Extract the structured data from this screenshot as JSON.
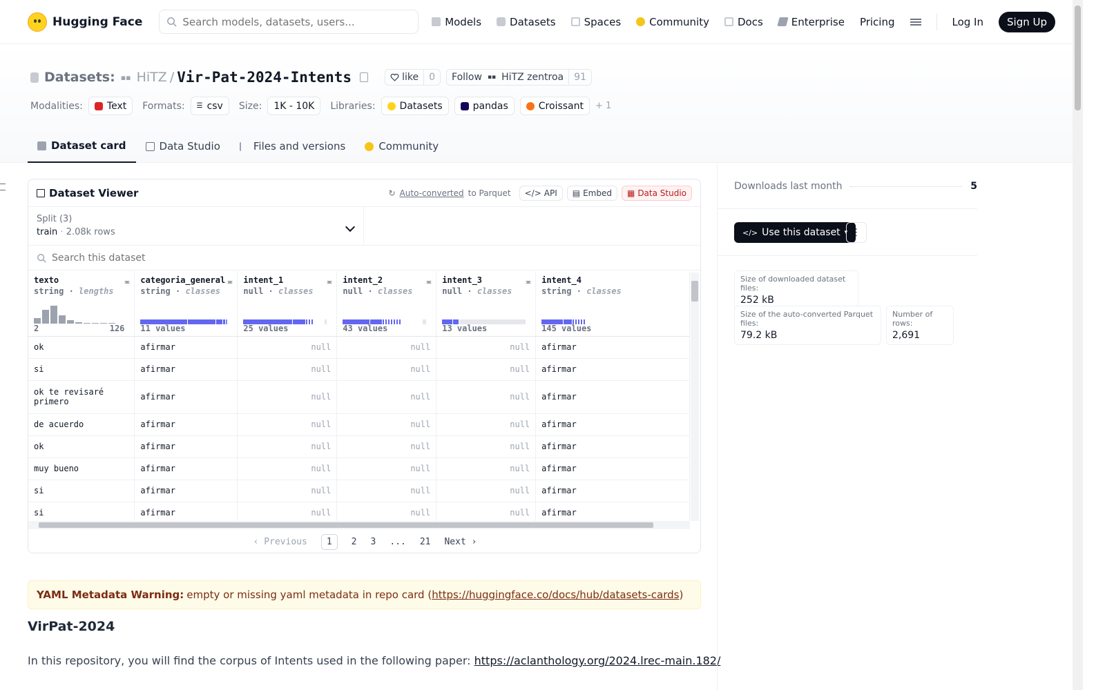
{
  "nav": {
    "brand": "Hugging Face",
    "search_placeholder": "Search models, datasets, users...",
    "links": [
      "Models",
      "Datasets",
      "Spaces",
      "Community",
      "Docs",
      "Enterprise",
      "Pricing"
    ],
    "login": "Log In",
    "signup": "Sign Up"
  },
  "repo": {
    "type_label": "Datasets:",
    "org": "HiTZ",
    "slash": "/",
    "name": "Vir-Pat-2024-Intents",
    "like_label": "like",
    "like_count": "0",
    "follow_label": "Follow",
    "follow_org": "HiTZ zentroa",
    "follow_count": "91"
  },
  "meta": {
    "modalities_label": "Modalities:",
    "modality": "Text",
    "formats_label": "Formats:",
    "format": "csv",
    "size_label": "Size:",
    "size": "1K - 10K",
    "libraries_label": "Libraries:",
    "libraries": [
      "Datasets",
      "pandas",
      "Croissant"
    ],
    "more_libraries": "+ 1"
  },
  "tabs": [
    "Dataset card",
    "Data Studio",
    "Files and versions",
    "Community"
  ],
  "viewer": {
    "title": "Dataset Viewer",
    "auto_converted": "Auto-converted",
    "to_parquet": "to Parquet",
    "api": "API",
    "embed": "Embed",
    "data_studio": "Data Studio",
    "split_label": "Split (3)",
    "split_name": "train",
    "split_dot": "·",
    "split_rows": "2.08k rows",
    "search_placeholder": "Search this dataset",
    "columns": [
      {
        "name": "texto",
        "type": "string",
        "kind": "lengths",
        "foot_left": "2",
        "foot_right": "126"
      },
      {
        "name": "categoria_general",
        "type": "string",
        "kind": "classes",
        "foot_left": "11 values",
        "foot_right": ""
      },
      {
        "name": "intent_1",
        "type": "null",
        "kind": "classes",
        "foot_left": "25 values",
        "foot_right": ""
      },
      {
        "name": "intent_2",
        "type": "null",
        "kind": "classes",
        "foot_left": "43 values",
        "foot_right": ""
      },
      {
        "name": "intent_3",
        "type": "null",
        "kind": "classes",
        "foot_left": "13 values",
        "foot_right": ""
      },
      {
        "name": "intent_4",
        "type": "string",
        "kind": "classes",
        "foot_left": "145 values",
        "foot_right": ""
      }
    ],
    "rows": [
      [
        "ok",
        "afirmar",
        "null",
        "null",
        "null",
        "afirmar"
      ],
      [
        "si",
        "afirmar",
        "null",
        "null",
        "null",
        "afirmar"
      ],
      [
        "ok te revisaré primero",
        "afirmar",
        "null",
        "null",
        "null",
        "afirmar"
      ],
      [
        "de acuerdo",
        "afirmar",
        "null",
        "null",
        "null",
        "afirmar"
      ],
      [
        "ok",
        "afirmar",
        "null",
        "null",
        "null",
        "afirmar"
      ],
      [
        "muy bueno",
        "afirmar",
        "null",
        "null",
        "null",
        "afirmar"
      ],
      [
        "si",
        "afirmar",
        "null",
        "null",
        "null",
        "afirmar"
      ],
      [
        "si",
        "afirmar",
        "null",
        "null",
        "null",
        "afirmar"
      ]
    ],
    "pager": {
      "prev": "Previous",
      "pages": [
        "1",
        "2",
        "3",
        "...",
        "21"
      ],
      "next": "Next"
    }
  },
  "warning": {
    "label": "YAML Metadata Warning:",
    "text": "empty or missing yaml metadata in repo card (",
    "link": "https://huggingface.co/docs/hub/datasets-cards",
    "close": ")"
  },
  "card": {
    "heading": "VirPat-2024",
    "para": "In this repository, you will find the corpus of Intents used in the following paper:",
    "link": "https://aclanthology.org/2024.lrec-main.182/"
  },
  "sidebar": {
    "downloads_label": "Downloads last month",
    "downloads": "5",
    "use_button": "Use this dataset",
    "stats": [
      {
        "k": "Size of downloaded dataset files:",
        "v": "252 kB"
      },
      {
        "k": "Size of the auto-converted Parquet files:",
        "v": "79.2 kB"
      },
      {
        "k": "Number of rows:",
        "v": "2,691"
      }
    ]
  },
  "colors": {
    "accent": "#6366f1",
    "dark": "#0b0f19",
    "warn_bg": "#fefbe8"
  }
}
